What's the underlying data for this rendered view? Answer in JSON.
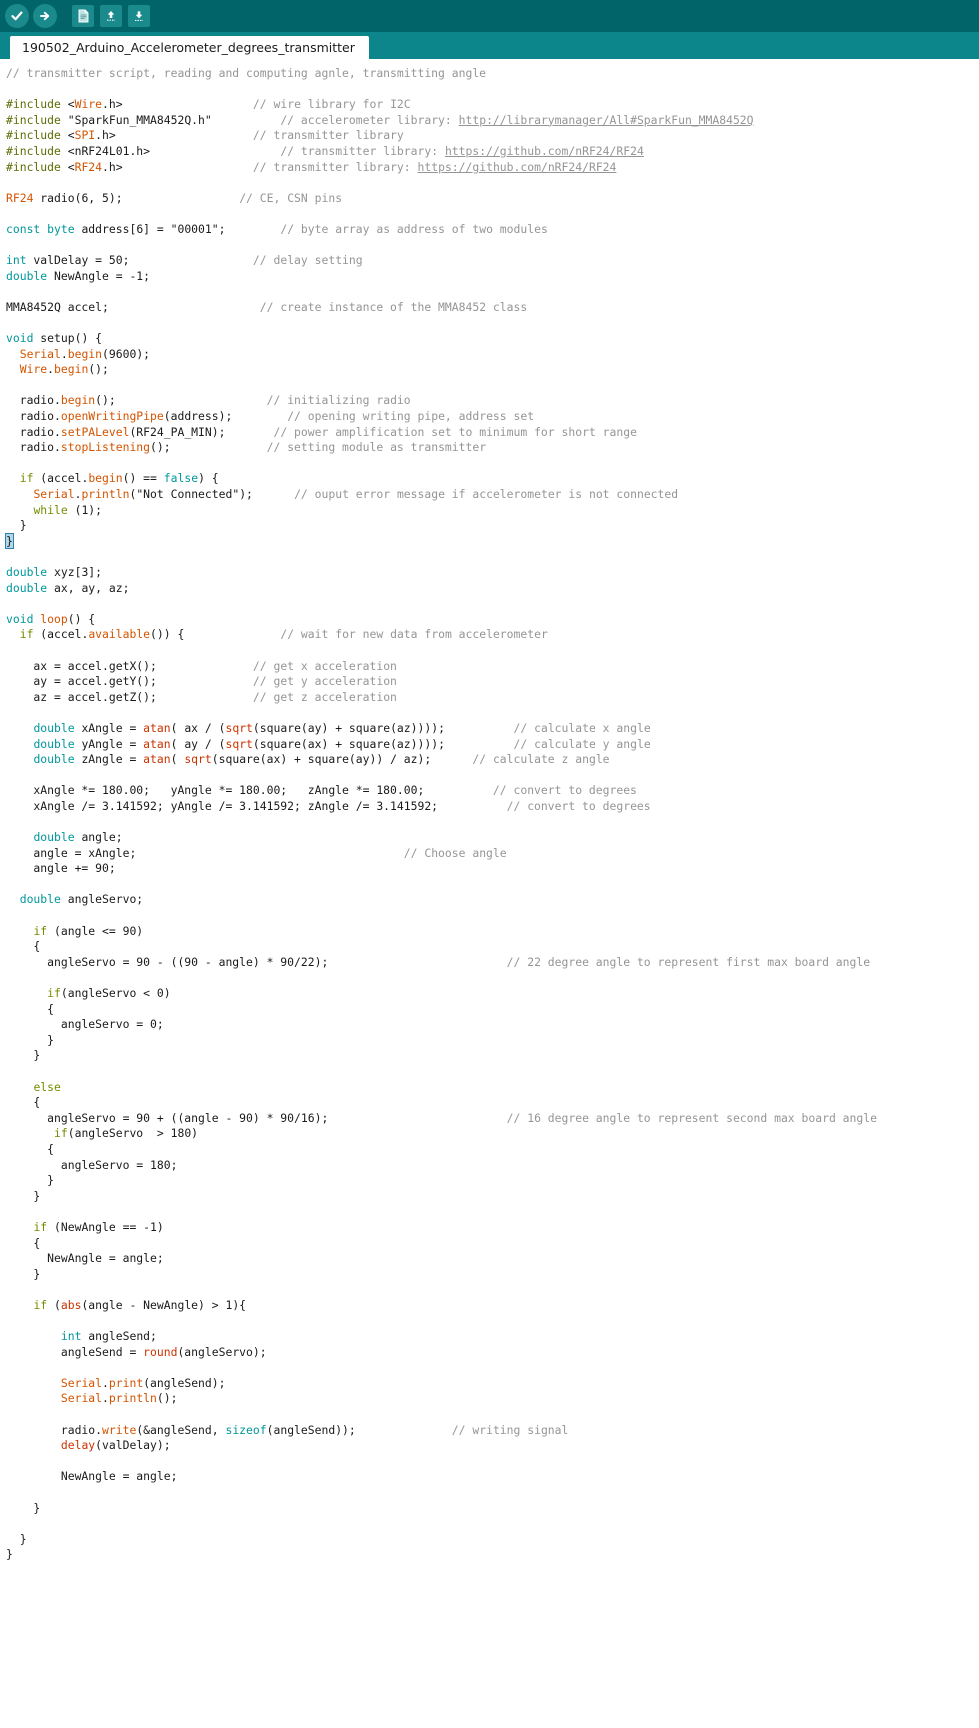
{
  "app": {
    "name": "Arduino IDE",
    "theme_bg": "#006468",
    "tabbar_bg": "#0c868a",
    "editor_bg": "#ffffff"
  },
  "toolbar": {
    "buttons": [
      {
        "name": "verify-button",
        "icon": "check-icon",
        "label": "Verify"
      },
      {
        "name": "upload-button",
        "icon": "arrow-right-icon",
        "label": "Upload"
      },
      {
        "name": "new-button",
        "icon": "new-file-icon",
        "label": "New"
      },
      {
        "name": "open-button",
        "icon": "arrow-up-icon",
        "label": "Open"
      },
      {
        "name": "save-button",
        "icon": "arrow-down-icon",
        "label": "Save"
      }
    ]
  },
  "tabs": {
    "active": "190502_Arduino_Accelerometer_degrees_transmitter"
  },
  "colors": {
    "keyword": "#00979c",
    "control": "#728e00",
    "library": "#d35400",
    "comment": "#959595",
    "preprocessor": "#5e6d03",
    "plain": "#1a1a1a",
    "selection": "#b0d8e8"
  },
  "code": {
    "lines": [
      [
        {
          "t": "// transmitter script, reading and computing agnle, transmitting angle",
          "c": "cm"
        }
      ],
      [],
      [
        {
          "t": "#include ",
          "c": "pre"
        },
        {
          "t": "<",
          "c": "pl"
        },
        {
          "t": "Wire",
          "c": "lib"
        },
        {
          "t": ".h>",
          "c": "pl"
        },
        {
          "t": "                   ",
          "c": "pl"
        },
        {
          "t": "// wire library for I2C",
          "c": "cm"
        }
      ],
      [
        {
          "t": "#include ",
          "c": "pre"
        },
        {
          "t": "\"SparkFun_MMA8452Q.h\"",
          "c": "pl"
        },
        {
          "t": "          ",
          "c": "pl"
        },
        {
          "t": "// accelerometer library: ",
          "c": "cm"
        },
        {
          "t": "http://librarymanager/All#SparkFun_MMA8452Q",
          "c": "lnk"
        }
      ],
      [
        {
          "t": "#include ",
          "c": "pre"
        },
        {
          "t": "<",
          "c": "pl"
        },
        {
          "t": "SPI",
          "c": "lib"
        },
        {
          "t": ".h>",
          "c": "pl"
        },
        {
          "t": "                    ",
          "c": "pl"
        },
        {
          "t": "// transmitter library",
          "c": "cm"
        }
      ],
      [
        {
          "t": "#include ",
          "c": "pre"
        },
        {
          "t": "<nRF24L01.h>",
          "c": "pl"
        },
        {
          "t": "                   ",
          "c": "pl"
        },
        {
          "t": "// transmitter library: ",
          "c": "cm"
        },
        {
          "t": "https://github.com/nRF24/RF24",
          "c": "lnk"
        }
      ],
      [
        {
          "t": "#include ",
          "c": "pre"
        },
        {
          "t": "<",
          "c": "pl"
        },
        {
          "t": "RF24",
          "c": "lib"
        },
        {
          "t": ".h>",
          "c": "pl"
        },
        {
          "t": "                   ",
          "c": "pl"
        },
        {
          "t": "// transmitter library: ",
          "c": "cm"
        },
        {
          "t": "https://github.com/nRF24/RF24",
          "c": "lnk"
        }
      ],
      [],
      [
        {
          "t": "RF24",
          "c": "lib"
        },
        {
          "t": " radio(6, 5);",
          "c": "pl"
        },
        {
          "t": "                 ",
          "c": "pl"
        },
        {
          "t": "// CE, CSN pins",
          "c": "cm"
        }
      ],
      [],
      [
        {
          "t": "const",
          "c": "kw"
        },
        {
          "t": " ",
          "c": "pl"
        },
        {
          "t": "byte",
          "c": "kw"
        },
        {
          "t": " address[6] = \"00001\";",
          "c": "pl"
        },
        {
          "t": "        ",
          "c": "pl"
        },
        {
          "t": "// byte array as address of two modules",
          "c": "cm"
        }
      ],
      [],
      [
        {
          "t": "int",
          "c": "kw"
        },
        {
          "t": " valDelay = 50;",
          "c": "pl"
        },
        {
          "t": "                  ",
          "c": "pl"
        },
        {
          "t": "// delay setting",
          "c": "cm"
        }
      ],
      [
        {
          "t": "double",
          "c": "kw"
        },
        {
          "t": " NewAngle = -1;",
          "c": "pl"
        }
      ],
      [],
      [
        {
          "t": "MMA8452Q accel;",
          "c": "pl"
        },
        {
          "t": "                      ",
          "c": "pl"
        },
        {
          "t": "// create instance of the MMA8452 class",
          "c": "cm"
        }
      ],
      [],
      [
        {
          "t": "void",
          "c": "kw"
        },
        {
          "t": " setup() {",
          "c": "pl"
        }
      ],
      [
        {
          "t": "  ",
          "c": "pl"
        },
        {
          "t": "Serial",
          "c": "lib"
        },
        {
          "t": ".",
          "c": "pl"
        },
        {
          "t": "begin",
          "c": "fn"
        },
        {
          "t": "(9600);",
          "c": "pl"
        }
      ],
      [
        {
          "t": "  ",
          "c": "pl"
        },
        {
          "t": "Wire",
          "c": "lib"
        },
        {
          "t": ".",
          "c": "pl"
        },
        {
          "t": "begin",
          "c": "fn"
        },
        {
          "t": "();",
          "c": "pl"
        }
      ],
      [],
      [
        {
          "t": "  radio.",
          "c": "pl"
        },
        {
          "t": "begin",
          "c": "fn"
        },
        {
          "t": "();",
          "c": "pl"
        },
        {
          "t": "                      ",
          "c": "pl"
        },
        {
          "t": "// initializing radio",
          "c": "cm"
        }
      ],
      [
        {
          "t": "  radio.",
          "c": "pl"
        },
        {
          "t": "openWritingPipe",
          "c": "fn"
        },
        {
          "t": "(address);",
          "c": "pl"
        },
        {
          "t": "        ",
          "c": "pl"
        },
        {
          "t": "// opening writing pipe, address set",
          "c": "cm"
        }
      ],
      [
        {
          "t": "  radio.",
          "c": "pl"
        },
        {
          "t": "setPALevel",
          "c": "fn"
        },
        {
          "t": "(RF24_PA_MIN);",
          "c": "pl"
        },
        {
          "t": "       ",
          "c": "pl"
        },
        {
          "t": "// power amplification set to minimum for short range",
          "c": "cm"
        }
      ],
      [
        {
          "t": "  radio.",
          "c": "pl"
        },
        {
          "t": "stopListening",
          "c": "fn"
        },
        {
          "t": "();",
          "c": "pl"
        },
        {
          "t": "              ",
          "c": "pl"
        },
        {
          "t": "// setting module as transmitter",
          "c": "cm"
        }
      ],
      [],
      [
        {
          "t": "  ",
          "c": "pl"
        },
        {
          "t": "if",
          "c": "ctrl"
        },
        {
          "t": " (accel.",
          "c": "pl"
        },
        {
          "t": "begin",
          "c": "fn"
        },
        {
          "t": "() == ",
          "c": "pl"
        },
        {
          "t": "false",
          "c": "kw"
        },
        {
          "t": ") {",
          "c": "pl"
        }
      ],
      [
        {
          "t": "    ",
          "c": "pl"
        },
        {
          "t": "Serial",
          "c": "lib"
        },
        {
          "t": ".",
          "c": "pl"
        },
        {
          "t": "println",
          "c": "fn"
        },
        {
          "t": "(\"Not Connected\");",
          "c": "pl"
        },
        {
          "t": "      ",
          "c": "pl"
        },
        {
          "t": "// ouput error message if accelerometer is not connected",
          "c": "cm"
        }
      ],
      [
        {
          "t": "    ",
          "c": "pl"
        },
        {
          "t": "while",
          "c": "ctrl"
        },
        {
          "t": " (1);",
          "c": "pl"
        }
      ],
      [
        {
          "t": "  }",
          "c": "pl"
        }
      ],
      [
        {
          "t": "}",
          "c": "pl",
          "sel": true,
          "caret": true
        }
      ],
      [],
      [
        {
          "t": "double",
          "c": "kw"
        },
        {
          "t": " xyz[3];",
          "c": "pl"
        }
      ],
      [
        {
          "t": "double",
          "c": "kw"
        },
        {
          "t": " ax, ay, az;",
          "c": "pl"
        }
      ],
      [],
      [
        {
          "t": "void",
          "c": "kw"
        },
        {
          "t": " ",
          "c": "pl"
        },
        {
          "t": "loop",
          "c": "fn"
        },
        {
          "t": "() {",
          "c": "pl"
        }
      ],
      [
        {
          "t": "  ",
          "c": "pl"
        },
        {
          "t": "if",
          "c": "ctrl"
        },
        {
          "t": " (accel.",
          "c": "pl"
        },
        {
          "t": "available",
          "c": "fn"
        },
        {
          "t": "()) {",
          "c": "pl"
        },
        {
          "t": "              ",
          "c": "pl"
        },
        {
          "t": "// wait for new data from accelerometer",
          "c": "cm"
        }
      ],
      [],
      [
        {
          "t": "    ax = accel.getX();",
          "c": "pl"
        },
        {
          "t": "              ",
          "c": "pl"
        },
        {
          "t": "// get x acceleration",
          "c": "cm"
        }
      ],
      [
        {
          "t": "    ay = accel.getY();",
          "c": "pl"
        },
        {
          "t": "              ",
          "c": "pl"
        },
        {
          "t": "// get y acceleration",
          "c": "cm"
        }
      ],
      [
        {
          "t": "    az = accel.getZ();",
          "c": "pl"
        },
        {
          "t": "              ",
          "c": "pl"
        },
        {
          "t": "// get z acceleration",
          "c": "cm"
        }
      ],
      [],
      [
        {
          "t": "    ",
          "c": "pl"
        },
        {
          "t": "double",
          "c": "kw"
        },
        {
          "t": " xAngle = ",
          "c": "pl"
        },
        {
          "t": "atan",
          "c": "fn2"
        },
        {
          "t": "( ax / (",
          "c": "pl"
        },
        {
          "t": "sqrt",
          "c": "fn2"
        },
        {
          "t": "(square(ay) + square(az))));",
          "c": "pl"
        },
        {
          "t": "          ",
          "c": "pl"
        },
        {
          "t": "// calculate x angle",
          "c": "cm"
        }
      ],
      [
        {
          "t": "    ",
          "c": "pl"
        },
        {
          "t": "double",
          "c": "kw"
        },
        {
          "t": " yAngle = ",
          "c": "pl"
        },
        {
          "t": "atan",
          "c": "fn2"
        },
        {
          "t": "( ay / (",
          "c": "pl"
        },
        {
          "t": "sqrt",
          "c": "fn2"
        },
        {
          "t": "(square(ax) + square(az))));",
          "c": "pl"
        },
        {
          "t": "          ",
          "c": "pl"
        },
        {
          "t": "// calculate y angle",
          "c": "cm"
        }
      ],
      [
        {
          "t": "    ",
          "c": "pl"
        },
        {
          "t": "double",
          "c": "kw"
        },
        {
          "t": " zAngle = ",
          "c": "pl"
        },
        {
          "t": "atan",
          "c": "fn2"
        },
        {
          "t": "( ",
          "c": "pl"
        },
        {
          "t": "sqrt",
          "c": "fn2"
        },
        {
          "t": "(square(ax) + square(ay)) / az);",
          "c": "pl"
        },
        {
          "t": "      ",
          "c": "pl"
        },
        {
          "t": "// calculate z angle",
          "c": "cm"
        }
      ],
      [],
      [
        {
          "t": "    xAngle *= 180.00;   yAngle *= 180.00;   zAngle *= 180.00;",
          "c": "pl"
        },
        {
          "t": "          ",
          "c": "pl"
        },
        {
          "t": "// convert to degrees",
          "c": "cm"
        }
      ],
      [
        {
          "t": "    xAngle /= 3.141592; yAngle /= 3.141592; zAngle /= 3.141592;",
          "c": "pl"
        },
        {
          "t": "          ",
          "c": "pl"
        },
        {
          "t": "// convert to degrees",
          "c": "cm"
        }
      ],
      [],
      [
        {
          "t": "    ",
          "c": "pl"
        },
        {
          "t": "double",
          "c": "kw"
        },
        {
          "t": " angle;",
          "c": "pl"
        }
      ],
      [
        {
          "t": "    angle = xAngle;",
          "c": "pl"
        },
        {
          "t": "                                       ",
          "c": "pl"
        },
        {
          "t": "// Choose angle",
          "c": "cm"
        }
      ],
      [
        {
          "t": "    angle += 90;",
          "c": "pl"
        }
      ],
      [],
      [
        {
          "t": "  ",
          "c": "pl"
        },
        {
          "t": "double",
          "c": "kw"
        },
        {
          "t": " angleServo;",
          "c": "pl"
        }
      ],
      [],
      [
        {
          "t": "    ",
          "c": "pl"
        },
        {
          "t": "if",
          "c": "ctrl"
        },
        {
          "t": " (angle <= 90)",
          "c": "pl"
        }
      ],
      [
        {
          "t": "    {",
          "c": "pl"
        }
      ],
      [
        {
          "t": "      angleServo = 90 - ((90 - angle) * 90/22);",
          "c": "pl"
        },
        {
          "t": "                          ",
          "c": "pl"
        },
        {
          "t": "// 22 degree angle to represent first max board angle",
          "c": "cm"
        }
      ],
      [],
      [
        {
          "t": "      ",
          "c": "pl"
        },
        {
          "t": "if",
          "c": "ctrl"
        },
        {
          "t": "(angleServo < 0)",
          "c": "pl"
        }
      ],
      [
        {
          "t": "      {",
          "c": "pl"
        }
      ],
      [
        {
          "t": "        angleServo = 0;",
          "c": "pl"
        }
      ],
      [
        {
          "t": "      }",
          "c": "pl"
        }
      ],
      [
        {
          "t": "    }",
          "c": "pl"
        }
      ],
      [],
      [
        {
          "t": "    ",
          "c": "pl"
        },
        {
          "t": "else",
          "c": "ctrl"
        }
      ],
      [
        {
          "t": "    {",
          "c": "pl"
        }
      ],
      [
        {
          "t": "      angleServo = 90 + ((angle - 90) * 90/16);",
          "c": "pl"
        },
        {
          "t": "                          ",
          "c": "pl"
        },
        {
          "t": "// 16 degree angle to represent second max board angle",
          "c": "cm"
        }
      ],
      [
        {
          "t": "       ",
          "c": "pl"
        },
        {
          "t": "if",
          "c": "ctrl"
        },
        {
          "t": "(angleServo  > 180)",
          "c": "pl"
        }
      ],
      [
        {
          "t": "      {",
          "c": "pl"
        }
      ],
      [
        {
          "t": "        angleServo = 180;",
          "c": "pl"
        }
      ],
      [
        {
          "t": "      }",
          "c": "pl"
        }
      ],
      [
        {
          "t": "    }",
          "c": "pl"
        }
      ],
      [],
      [
        {
          "t": "    ",
          "c": "pl"
        },
        {
          "t": "if",
          "c": "ctrl"
        },
        {
          "t": " (NewAngle == -1)",
          "c": "pl"
        }
      ],
      [
        {
          "t": "    {",
          "c": "pl"
        }
      ],
      [
        {
          "t": "      NewAngle = angle;",
          "c": "pl"
        }
      ],
      [
        {
          "t": "    }",
          "c": "pl"
        }
      ],
      [],
      [
        {
          "t": "    ",
          "c": "pl"
        },
        {
          "t": "if",
          "c": "ctrl"
        },
        {
          "t": " (",
          "c": "pl"
        },
        {
          "t": "abs",
          "c": "fn2"
        },
        {
          "t": "(angle - NewAngle) > 1){",
          "c": "pl"
        }
      ],
      [],
      [
        {
          "t": "        ",
          "c": "pl"
        },
        {
          "t": "int",
          "c": "kw"
        },
        {
          "t": " angleSend;",
          "c": "pl"
        }
      ],
      [
        {
          "t": "        angleSend = ",
          "c": "pl"
        },
        {
          "t": "round",
          "c": "fn2"
        },
        {
          "t": "(angleServo);",
          "c": "pl"
        }
      ],
      [],
      [
        {
          "t": "        ",
          "c": "pl"
        },
        {
          "t": "Serial",
          "c": "lib"
        },
        {
          "t": ".",
          "c": "pl"
        },
        {
          "t": "print",
          "c": "fn"
        },
        {
          "t": "(angleSend);",
          "c": "pl"
        }
      ],
      [
        {
          "t": "        ",
          "c": "pl"
        },
        {
          "t": "Serial",
          "c": "lib"
        },
        {
          "t": ".",
          "c": "pl"
        },
        {
          "t": "println",
          "c": "fn"
        },
        {
          "t": "();",
          "c": "pl"
        }
      ],
      [],
      [
        {
          "t": "        radio.",
          "c": "pl"
        },
        {
          "t": "write",
          "c": "fn"
        },
        {
          "t": "(&angleSend, ",
          "c": "pl"
        },
        {
          "t": "sizeof",
          "c": "kw"
        },
        {
          "t": "(angleSend));",
          "c": "pl"
        },
        {
          "t": "              ",
          "c": "pl"
        },
        {
          "t": "// writing signal",
          "c": "cm"
        }
      ],
      [
        {
          "t": "        ",
          "c": "pl"
        },
        {
          "t": "delay",
          "c": "fn2"
        },
        {
          "t": "(valDelay);",
          "c": "pl"
        }
      ],
      [],
      [
        {
          "t": "        NewAngle = angle;",
          "c": "pl"
        }
      ],
      [],
      [
        {
          "t": "    }",
          "c": "pl"
        }
      ],
      [],
      [
        {
          "t": "  }",
          "c": "pl"
        }
      ],
      [
        {
          "t": "}",
          "c": "pl"
        }
      ]
    ]
  }
}
